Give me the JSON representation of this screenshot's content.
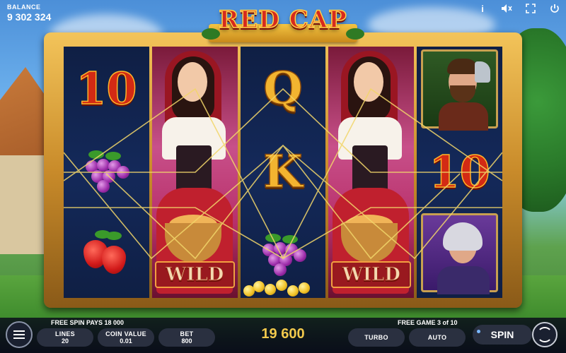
{
  "balance": {
    "label": "BALANCE",
    "value": "9 302 324"
  },
  "top_icons": [
    {
      "name": "info-icon",
      "glyph": "i"
    },
    {
      "name": "sound-icon",
      "glyph": "🔈"
    },
    {
      "name": "fullscreen-icon",
      "glyph": "⛶"
    },
    {
      "name": "power-icon",
      "glyph": "⏻"
    }
  ],
  "logo": {
    "text": "RED CAP"
  },
  "reels": {
    "reel1": {
      "top": "10",
      "bottom_fruit": "strawberries",
      "mid_fruit": "grapes"
    },
    "reel3": {
      "top": "Q",
      "mid": "K",
      "bottom_fruit": "grapes"
    },
    "reel5": {
      "mid": "10"
    },
    "wild_label": "WILD"
  },
  "status": {
    "free_spin_pays": "FREE SPIN PAYS 18 000",
    "free_game": "FREE GAME 3 of 10"
  },
  "controls": {
    "lines_label": "LINES",
    "lines_value": "20",
    "coin_value_label": "COIN VALUE",
    "coin_value_value": "0.01",
    "bet_label": "BET",
    "bet_value": "800",
    "win_value": "19 600",
    "turbo_label": "TURBO",
    "auto_label": "AUTO",
    "spin_label": "SPIN"
  },
  "colors": {
    "win": "#f2c94c",
    "frame_gold": "#c98b2a",
    "reel_bg": "#14295a"
  }
}
